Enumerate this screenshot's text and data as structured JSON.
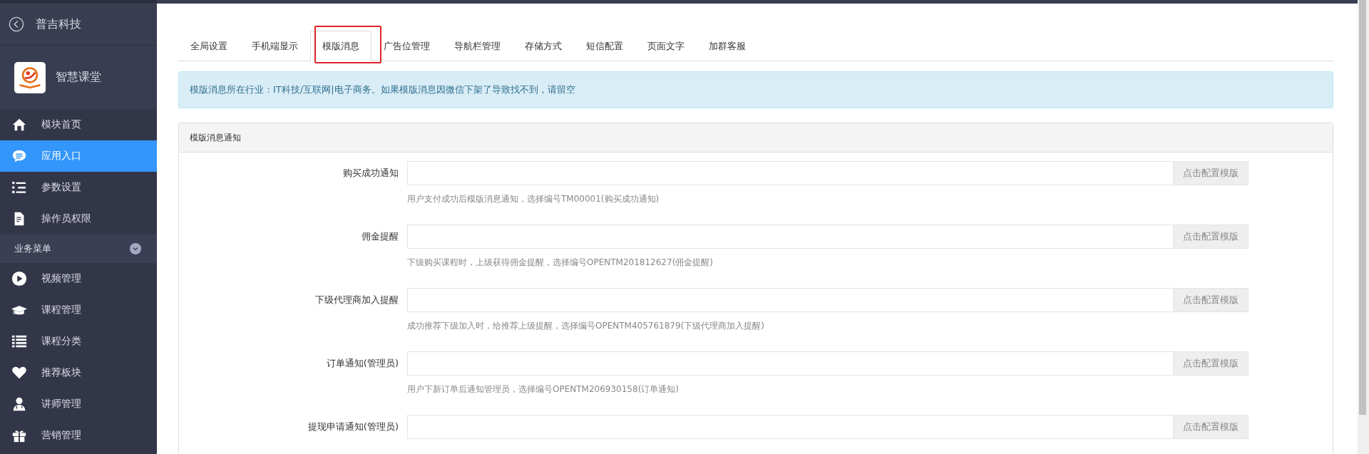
{
  "sidebar": {
    "back_title": "普吉科技",
    "app_name": "智慧课堂",
    "items": [
      {
        "label": "模块首页",
        "kind": "home",
        "selected": false
      },
      {
        "label": "应用入口",
        "kind": "chat",
        "selected": true
      },
      {
        "label": "参数设置",
        "kind": "settings",
        "selected": false
      },
      {
        "label": "操作员权限",
        "kind": "permission",
        "selected": false
      }
    ],
    "group": {
      "label": "业务菜单",
      "expanded": true,
      "items": [
        {
          "label": "视频管理",
          "kind": "video",
          "selected": false
        },
        {
          "label": "课程管理",
          "kind": "course",
          "selected": false
        },
        {
          "label": "课程分类",
          "kind": "category",
          "selected": false
        },
        {
          "label": "推荐板块",
          "kind": "recommend",
          "selected": false
        },
        {
          "label": "讲师管理",
          "kind": "teacher",
          "selected": false
        },
        {
          "label": "营销管理",
          "kind": "marketing",
          "selected": false
        }
      ]
    }
  },
  "tabs": [
    {
      "label": "全局设置",
      "selected": false,
      "highlighted": false
    },
    {
      "label": "手机端显示",
      "selected": false,
      "highlighted": false
    },
    {
      "label": "模版消息",
      "selected": true,
      "highlighted": true
    },
    {
      "label": "广告位管理",
      "selected": false,
      "highlighted": false
    },
    {
      "label": "导航栏管理",
      "selected": false,
      "highlighted": false
    },
    {
      "label": "存储方式",
      "selected": false,
      "highlighted": false
    },
    {
      "label": "短信配置",
      "selected": false,
      "highlighted": false
    },
    {
      "label": "页面文字",
      "selected": false,
      "highlighted": false
    },
    {
      "label": "加群客服",
      "selected": false,
      "highlighted": false
    }
  ],
  "alert": "模版消息所在行业：IT科技/互联网|电子商务。如果模版消息因微信下架了导致找不到，请留空",
  "panel": {
    "title": "模版消息通知",
    "fields": [
      {
        "label": "购买成功通知",
        "button": "点击配置模版",
        "help": "用户支付成功后模版消息通知，选择编号TM00001(购买成功通知)"
      },
      {
        "label": "佣金提醒",
        "button": "点击配置模版",
        "help": "下级购买课程时，上级获得佣金提醒，选择编号OPENTM201812627(佣金提醒)"
      },
      {
        "label": "下级代理商加入提醒",
        "button": "点击配置模版",
        "help": "成功推荐下级加入时，给推荐上级提醒，选择编号OPENTM405761879(下级代理商加入提醒)"
      },
      {
        "label": "订单通知(管理员)",
        "button": "点击配置模版",
        "help": "用户下新订单后通知管理员，选择编号OPENTM206930158(订单通知)"
      },
      {
        "label": "提现申请通知(管理员)",
        "button": "点击配置模版"
      }
    ]
  }
}
